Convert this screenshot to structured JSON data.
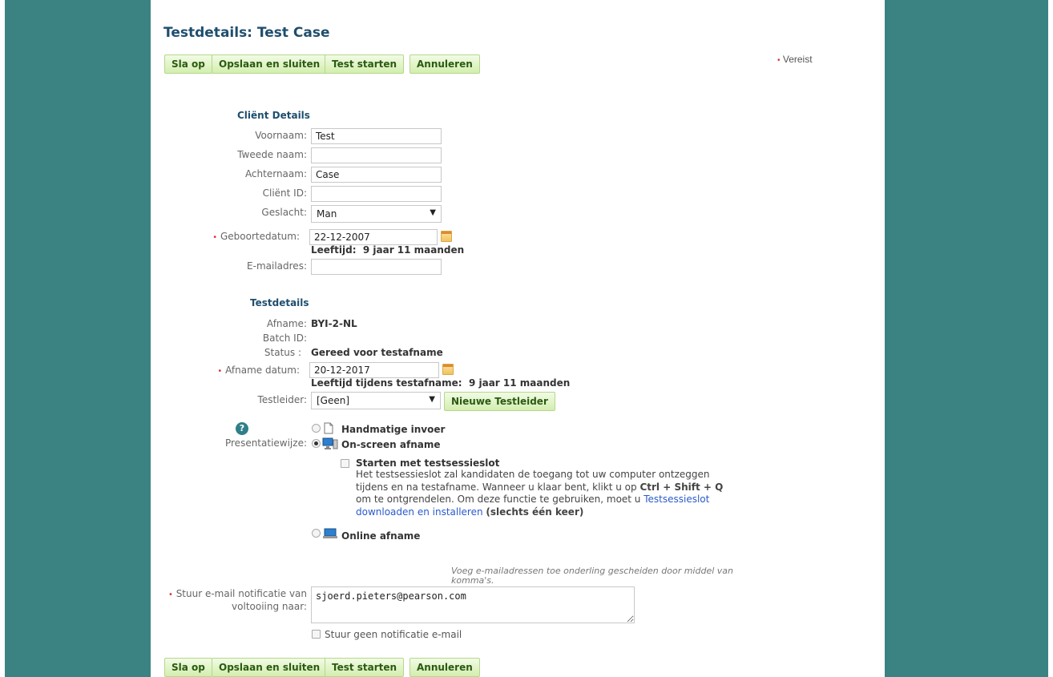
{
  "page_title": "Testdetails: Test Case",
  "toolbar": {
    "save": "Sla op",
    "save_close": "Opslaan en sluiten",
    "start_test": "Test starten",
    "cancel": "Annuleren"
  },
  "required_note": "Vereist",
  "client": {
    "heading": "Cliënt Details",
    "first_name_label": "Voornaam:",
    "first_name_value": "Test",
    "middle_name_label": "Tweede naam:",
    "middle_name_value": "",
    "last_name_label": "Achternaam:",
    "last_name_value": "Case",
    "client_id_label": "Cliënt ID:",
    "client_id_value": "",
    "gender_label": "Geslacht:",
    "gender_value": "Man",
    "dob_label": "Geboortedatum:",
    "dob_value": "22-12-2007",
    "age_label": "Leeftijd:",
    "age_value": "9 jaar 11 maanden",
    "email_label": "E-mailadres:",
    "email_value": ""
  },
  "test": {
    "heading": "Testdetails",
    "afname_label": "Afname:",
    "afname_value": "BYI-2-NL",
    "batch_label": "Batch ID:",
    "batch_value": "",
    "status_label": "Status :",
    "status_value": "Gereed voor testafname",
    "date_label": "Afname datum:",
    "date_value": "20-12-2017",
    "age_at_test_label": "Leeftijd tijdens testafname:",
    "age_at_test_value": "9 jaar 11 maanden",
    "leader_label": "Testleider:",
    "leader_value": "[Geen]",
    "new_leader_button": "Nieuwe Testleider"
  },
  "presentation": {
    "label": "Presentatiewijze:",
    "manual": "Handmatige invoer",
    "onscreen": "On-screen afname",
    "lock_title": "Starten met testsessieslot",
    "lock_line1": "Het testsessieslot zal kandidaten de toegang tot uw computer ontzeggen",
    "lock_line2_a": "tijdens en na testafname. Wanneer u klaar bent, klikt u op ",
    "lock_keys": "Ctrl + Shift + Q",
    "lock_line3": "om te ontgrendelen. Om deze functie te gebruiken, moet u ",
    "lock_link_1": "Testsessieslot",
    "lock_link_2": "downloaden en installeren",
    "lock_once": "(slechts één keer)",
    "online": "Online afname",
    "selected": "onscreen"
  },
  "notification": {
    "hint_line1": "Voeg e-mailadressen toe onderling gescheiden door middel van",
    "hint_line2": "komma's.",
    "label_line1": "Stuur e-mail notificatie van",
    "label_line2": "voltooiing naar:",
    "value": "sjoerd.pieters@pearson.com",
    "no_notify": "Stuur geen notificatie e-mail"
  },
  "colors": {
    "side_panel": "#3b8383",
    "title": "#1f4e6e",
    "button_text": "#2a5a12",
    "required": "#d9353c",
    "link": "#2a5acb"
  }
}
